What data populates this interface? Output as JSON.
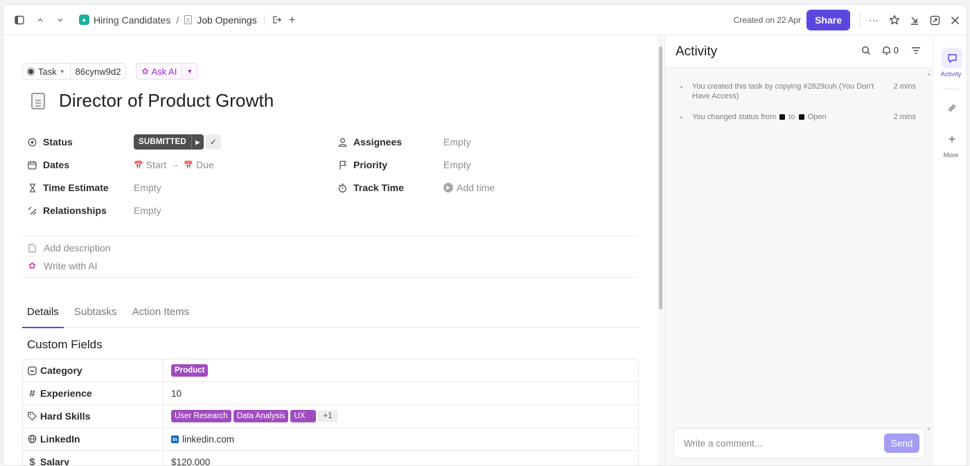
{
  "topbar": {
    "space_name": "Hiring Candidates",
    "separator": "/",
    "list_name": "Job Openings",
    "created": "Created on 22 Apr",
    "share_label": "Share"
  },
  "task": {
    "type_label": "Task",
    "task_id": "86cynw9d2",
    "ask_ai_label": "Ask AI",
    "title": "Director of Product Growth"
  },
  "fields": {
    "status_label": "Status",
    "status_value": "SUBMITTED",
    "dates_label": "Dates",
    "start_label": "Start",
    "due_label": "Due",
    "time_estimate_label": "Time Estimate",
    "time_estimate_value": "Empty",
    "relationships_label": "Relationships",
    "relationships_value": "Empty",
    "assignees_label": "Assignees",
    "assignees_value": "Empty",
    "priority_label": "Priority",
    "priority_value": "Empty",
    "track_time_label": "Track Time",
    "track_time_value": "Add time"
  },
  "description": {
    "add_description": "Add description",
    "write_with_ai": "Write with AI"
  },
  "tabs": [
    {
      "label": "Details",
      "active": true
    },
    {
      "label": "Subtasks",
      "active": false
    },
    {
      "label": "Action Items",
      "active": false
    }
  ],
  "custom_fields": {
    "title": "Custom Fields",
    "rows": [
      {
        "label": "Category",
        "icon": "dropdown-icon",
        "tags": [
          "Product"
        ]
      },
      {
        "label": "Experience",
        "icon": "hash-icon",
        "value": "10"
      },
      {
        "label": "Hard Skills",
        "icon": "tag-icon",
        "tags": [
          "User Research",
          "Data Analysis",
          "UX"
        ],
        "more": "+1"
      },
      {
        "label": "LinkedIn",
        "icon": "globe-icon",
        "value": "linkedin.com"
      },
      {
        "label": "Salary",
        "icon": "dollar-icon",
        "value": "$120,000"
      }
    ],
    "tag_color": "#a04cbe"
  },
  "activity": {
    "title": "Activity",
    "notif_count": "0",
    "items": [
      {
        "text": "You created this task by copying #2829cuh (You Don't Have Access)",
        "time": "2 mins"
      },
      {
        "text_before": "You changed status from",
        "text_mid": "to",
        "text_after": "Open",
        "time": "2 mins"
      }
    ],
    "comment_placeholder": "Write a comment...",
    "send_label": "Send"
  },
  "rail": {
    "activity_label": "Activity",
    "more_label": "More"
  },
  "colors": {
    "accent": "#5b47e0",
    "space_badge": "#1fae9e",
    "status_submitted": "#4f4f4f"
  }
}
